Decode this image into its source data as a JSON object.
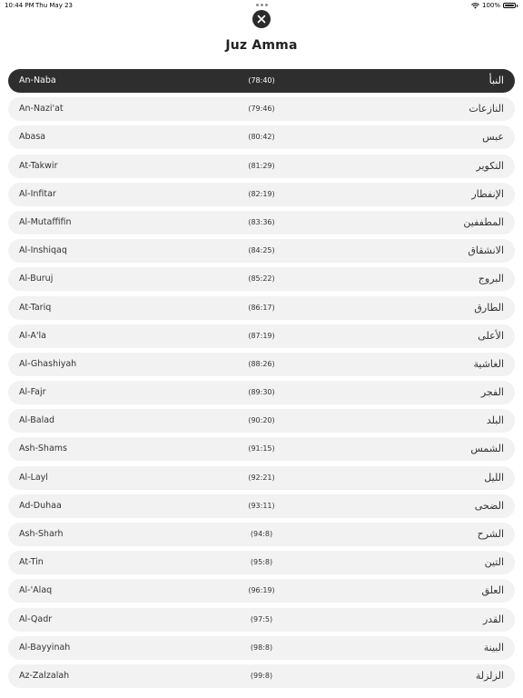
{
  "status": {
    "time": "10:44 PM",
    "date": "Thu May 23",
    "battery": "100%"
  },
  "icons": {
    "close": "close-icon",
    "wifi": "wifi-icon",
    "battery": "battery-icon"
  },
  "header": {
    "title": "Juz Amma"
  },
  "surahs": [
    {
      "name": "An-Naba",
      "ref": "(78:40)",
      "arabic": "النبأ",
      "selected": true
    },
    {
      "name": "An-Nazi'at",
      "ref": "(79:46)",
      "arabic": "النازعات"
    },
    {
      "name": "Abasa",
      "ref": "(80:42)",
      "arabic": "عبس"
    },
    {
      "name": "At-Takwir",
      "ref": "(81:29)",
      "arabic": "التكوير"
    },
    {
      "name": "Al-Infitar",
      "ref": "(82:19)",
      "arabic": "الإنفطار"
    },
    {
      "name": "Al-Mutaffifin",
      "ref": "(83:36)",
      "arabic": "المطففين"
    },
    {
      "name": "Al-Inshiqaq",
      "ref": "(84:25)",
      "arabic": "الانشقاق"
    },
    {
      "name": "Al-Buruj",
      "ref": "(85:22)",
      "arabic": "البروج"
    },
    {
      "name": "At-Tariq",
      "ref": "(86:17)",
      "arabic": "الطارق"
    },
    {
      "name": "Al-A'la",
      "ref": "(87:19)",
      "arabic": "الأعلى"
    },
    {
      "name": "Al-Ghashiyah",
      "ref": "(88:26)",
      "arabic": "الغاشية"
    },
    {
      "name": "Al-Fajr",
      "ref": "(89:30)",
      "arabic": "الفجر"
    },
    {
      "name": "Al-Balad",
      "ref": "(90:20)",
      "arabic": "البلد"
    },
    {
      "name": "Ash-Shams",
      "ref": "(91:15)",
      "arabic": "الشمس"
    },
    {
      "name": "Al-Layl",
      "ref": "(92:21)",
      "arabic": "الليل"
    },
    {
      "name": "Ad-Duhaa",
      "ref": "(93:11)",
      "arabic": "الضحى"
    },
    {
      "name": "Ash-Sharh",
      "ref": "(94:8)",
      "arabic": "الشرح"
    },
    {
      "name": "At-Tin",
      "ref": "(95:8)",
      "arabic": "التين"
    },
    {
      "name": "Al-'Alaq",
      "ref": "(96:19)",
      "arabic": "العلق"
    },
    {
      "name": "Al-Qadr",
      "ref": "(97:5)",
      "arabic": "القدر"
    },
    {
      "name": "Al-Bayyinah",
      "ref": "(98:8)",
      "arabic": "البينة"
    },
    {
      "name": "Az-Zalzalah",
      "ref": "(99:8)",
      "arabic": "الزلزلة"
    }
  ]
}
